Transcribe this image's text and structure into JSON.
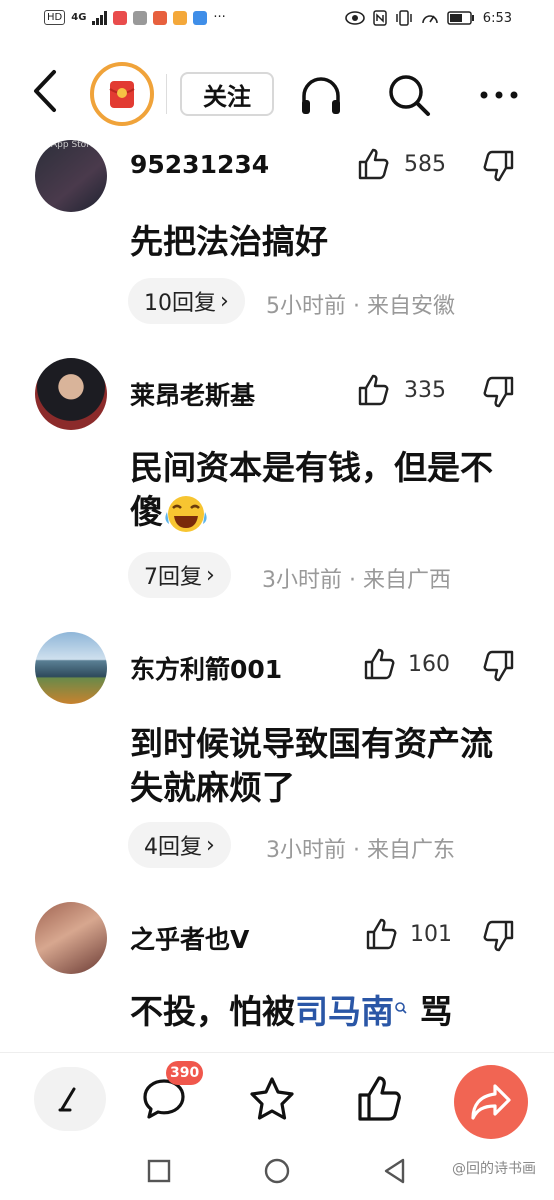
{
  "status_bar": {
    "left_badge": "HD",
    "network": "4G",
    "time": "6:53",
    "icons": [
      "eye-icon",
      "nfc-icon",
      "vibrate-icon",
      "speedometer-icon",
      "battery-icon"
    ]
  },
  "header": {
    "follow_label": "关注",
    "icons": [
      "back-icon",
      "headphones-icon",
      "search-icon",
      "more-icon"
    ]
  },
  "comments": [
    {
      "user": "95231234",
      "likes": "585",
      "text_parts": [
        "先把法治搞好"
      ],
      "replies": "10回复",
      "meta": "5小时前 · 来自安徽",
      "avatar_label": "App Store"
    },
    {
      "user": "莱昂老斯基",
      "likes": "335",
      "text_parts": [
        "民间资本是有钱，但是不傻"
      ],
      "replies": "7回复",
      "meta": "3小时前 · 来自广西",
      "emoji": "crying-laughing-emoji"
    },
    {
      "user": "东方利箭001",
      "likes": "160",
      "text_parts": [
        "到时候说导致国有资产流失就麻烦了"
      ],
      "replies": "4回复",
      "meta": "3小时前 · 来自广东"
    },
    {
      "user": "之乎者也V",
      "likes": "101",
      "text_before": "不投，怕被",
      "text_link": "司马南",
      "text_after": " 骂"
    }
  ],
  "bottom_bar": {
    "comment_badge": "390",
    "icons": [
      "write-icon",
      "comment-icon",
      "star-icon",
      "thumbs-up-icon",
      "share-icon"
    ]
  },
  "system_nav": {
    "watermark": "@回的诗书画",
    "icons": [
      "square-icon",
      "circle-icon",
      "triangle-back-icon"
    ]
  },
  "colors": {
    "accent_red": "#f16553",
    "badge_red": "#f0574c",
    "link_blue": "#2a56a6",
    "ring_orange": "#f0a33a"
  }
}
